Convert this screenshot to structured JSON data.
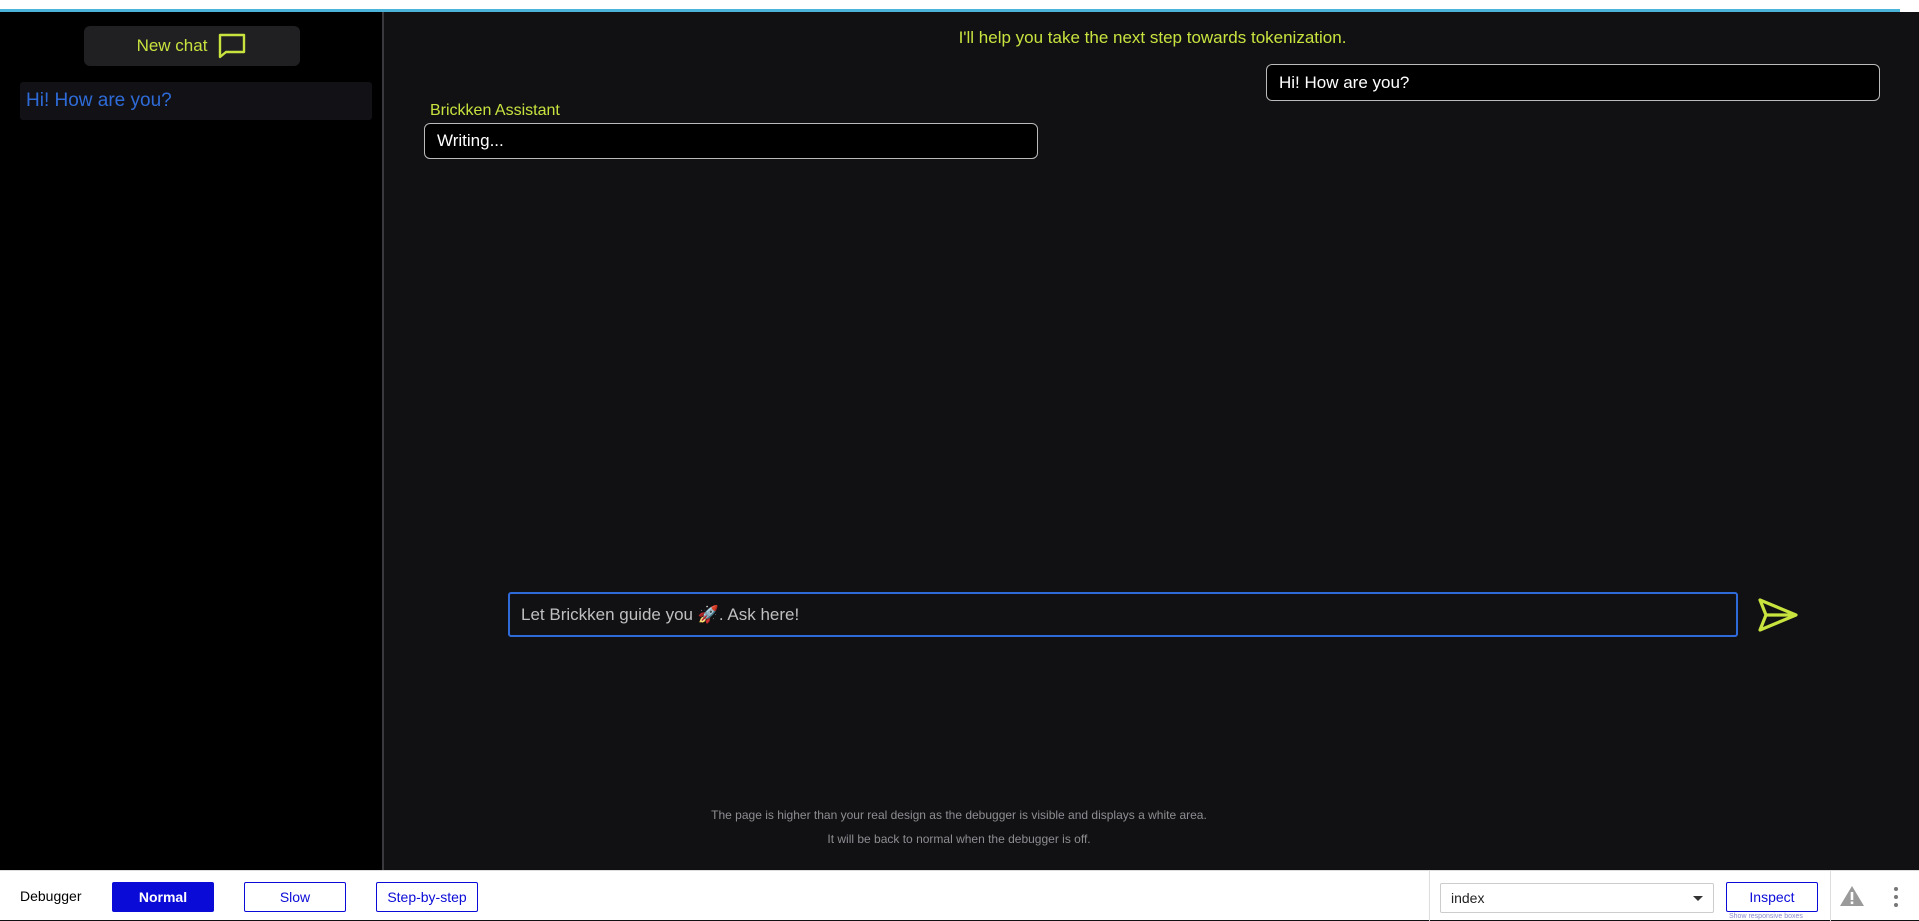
{
  "sidebar": {
    "new_chat_label": "New chat",
    "chats": [
      {
        "label": "Hi! How are you?"
      }
    ]
  },
  "main": {
    "tagline": "I'll help you take the next step towards tokenization.",
    "messages": [
      {
        "role": "user",
        "text": "Hi! How are you?"
      },
      {
        "role": "assistant",
        "author": "Brickken Assistant",
        "text": "Writing..."
      }
    ],
    "input": {
      "placeholder": "Let Brickken guide you 🚀. Ask here!",
      "value": ""
    },
    "send_icon": "send-icon",
    "notice_line1": "The page is higher than your real design as the debugger is visible and displays a white area.",
    "notice_line2": "It will be back to normal when the debugger is off."
  },
  "debugger": {
    "label": "Debugger",
    "modes": [
      {
        "label": "Normal",
        "active": true
      },
      {
        "label": "Slow",
        "active": false
      },
      {
        "label": "Step-by-step",
        "active": false
      }
    ],
    "page_select": "index",
    "inspect_label": "Inspect",
    "inspect_sub": "Show responsive boxes"
  },
  "colors": {
    "accent": "#c8e23e",
    "link": "#2e6bd8",
    "debugger_blue": "#0b0bd8",
    "background": "#111114"
  }
}
